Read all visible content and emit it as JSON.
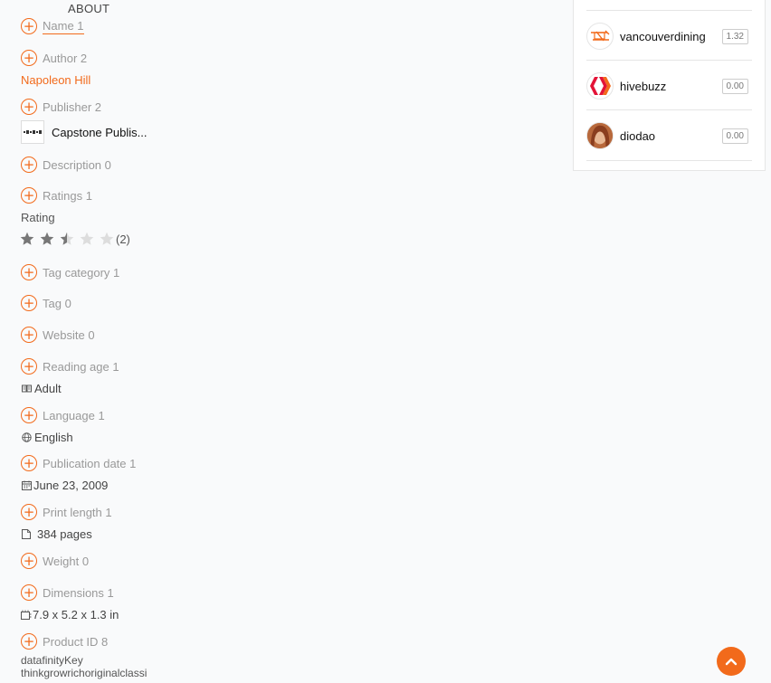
{
  "about": {
    "title": "ABOUT"
  },
  "sections": {
    "name": "Name 1",
    "author": "Author 2",
    "publisher": "Publisher 2",
    "description": "Description 0",
    "ratings": "Ratings 1",
    "tag_category": "Tag category 1",
    "tag": "Tag 0",
    "website": "Website 0",
    "reading_age": "Reading age 1",
    "language": "Language 1",
    "publication_date": "Publication date 1",
    "print_length": "Print length 1",
    "weight": "Weight 0",
    "dimensions": "Dimensions 1",
    "product_id": "Product ID 8"
  },
  "values": {
    "author": "Napoleon Hill",
    "publisher": "Capstone Publis...",
    "rating_label": "Rating",
    "rating_value": 2.5,
    "rating_max": 5,
    "rating_count": "(2)",
    "reading_age": "Adult",
    "language": "English",
    "publication_date": "June 23, 2009",
    "print_length": "384 pages",
    "dimensions": "7.9 x 5.2 x 1.3 in",
    "product_id_line1": "datafinityKey",
    "product_id_line2": "thinkgrowrichoriginalclassi"
  },
  "icons": {
    "section_toggle": "plus-circle-icon",
    "reading_age": "book-icon",
    "language": "globe-icon",
    "publication_date": "calendar-icon",
    "print_length": "page-icon",
    "dimensions": "ruler-icon",
    "scroll_top": "chevron-up-icon"
  },
  "voters": [
    {
      "name": "vancouverdining",
      "amount": "1.32"
    },
    {
      "name": "hivebuzz",
      "amount": "0.00"
    },
    {
      "name": "diodao",
      "amount": "0.00"
    }
  ],
  "colors": {
    "accent": "#f26a1b",
    "hive_red": "#e31337",
    "star_filled": "#777777",
    "star_empty": "#dddddd"
  }
}
